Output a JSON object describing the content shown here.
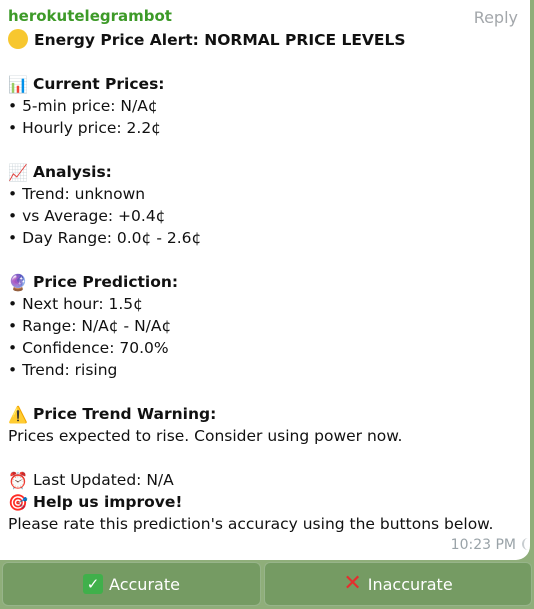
{
  "message": {
    "sender": "herokutelegrambot",
    "reply_label": "Reply",
    "time": "10:23 PM",
    "lines": [
      {
        "emoji": "yellow-circle",
        "text": "Energy Price Alert: NORMAL PRICE LEVELS",
        "bold": true
      },
      {
        "gap": true
      },
      {
        "emoji": "📊",
        "icon": "bar-chart-icon",
        "text": "Current Prices:",
        "bold": true
      },
      {
        "text": "• 5-min price: N/A¢"
      },
      {
        "text": "• Hourly price: 2.2¢"
      },
      {
        "gap": true
      },
      {
        "emoji": "📈",
        "icon": "trend-chart-icon",
        "text": "Analysis:",
        "bold": true
      },
      {
        "text": "• Trend: unknown"
      },
      {
        "text": "• vs Average: +0.4¢"
      },
      {
        "text": "• Day Range: 0.0¢ - 2.6¢"
      },
      {
        "gap": true
      },
      {
        "emoji": "🔮",
        "icon": "crystal-ball-icon",
        "text": "Price Prediction:",
        "bold": true
      },
      {
        "text": "• Next hour: 1.5¢"
      },
      {
        "text": "• Range: N/A¢ - N/A¢"
      },
      {
        "text": "• Confidence: 70.0%"
      },
      {
        "text": "• Trend: rising"
      },
      {
        "gap": true
      },
      {
        "emoji": "⚠️",
        "icon": "warning-icon",
        "text": "Price Trend Warning:",
        "bold": true
      },
      {
        "text": "Prices expected to rise. Consider using power now."
      },
      {
        "gap": true
      },
      {
        "emoji": "⏰",
        "icon": "alarm-clock-icon",
        "text": "Last Updated: N/A"
      },
      {
        "emoji": "🎯",
        "icon": "target-icon",
        "text": "Help us improve!",
        "bold": true
      },
      {
        "text": "Please rate this prediction's accuracy using the buttons below.",
        "wrap": true
      }
    ]
  },
  "keyboard": {
    "accurate_label": "Accurate",
    "inaccurate_label": "Inaccurate"
  },
  "colors": {
    "sender": "#3d9a28",
    "background": "#8fae7a",
    "check": "#40b04b",
    "cross": "#e52e2e"
  }
}
